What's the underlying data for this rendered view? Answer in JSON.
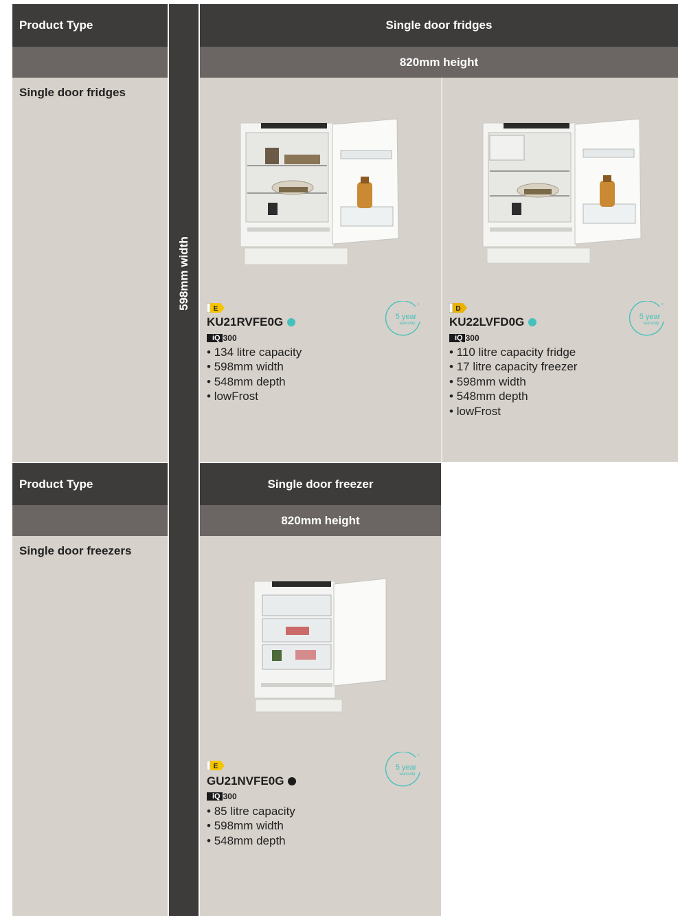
{
  "colors": {
    "dark": "#3e3c3b",
    "mid": "#6b6663",
    "beige": "#d6d1ca",
    "teal": "#45c1bd",
    "energy_yellow": "#f5c400",
    "energy_badge": "#e9b100"
  },
  "vertical_label": "598mm width",
  "sections": [
    {
      "header_label": "Product Type",
      "header_title": "Single door fridges",
      "height_label": "820mm height",
      "row_label": "Single door fridges",
      "products": [
        {
          "energy_class": "E",
          "model": "KU21RVFE0G",
          "model_icon": "home-connect-icon",
          "series_badge": "iQ",
          "series_number": "300",
          "specs": [
            "134 litre capacity",
            "598mm width",
            "548mm depth",
            "lowFrost"
          ],
          "warranty_years": "5 year",
          "warranty_word": "warranty",
          "warranty_mark": "*"
        },
        {
          "energy_class": "D",
          "model": "KU22LVFD0G",
          "model_icon": "home-connect-icon",
          "series_badge": "iQ",
          "series_number": "300",
          "specs": [
            "110 litre capacity fridge",
            "17 litre capacity freezer",
            "598mm width",
            "548mm depth",
            "lowFrost"
          ],
          "warranty_years": "5 year",
          "warranty_word": "warranty",
          "warranty_mark": "*"
        }
      ]
    },
    {
      "header_label": "Product Type",
      "header_title": "Single door freezer",
      "height_label": "820mm height",
      "row_label": "Single door freezers",
      "products": [
        {
          "energy_class": "E",
          "model": "GU21NVFE0G",
          "model_icon": "freshness-q-icon",
          "series_badge": "iQ",
          "series_number": "300",
          "specs": [
            "85 litre capacity",
            "598mm width",
            "548mm depth"
          ],
          "warranty_years": "5 year",
          "warranty_word": "warranty",
          "warranty_mark": "*"
        }
      ]
    }
  ]
}
